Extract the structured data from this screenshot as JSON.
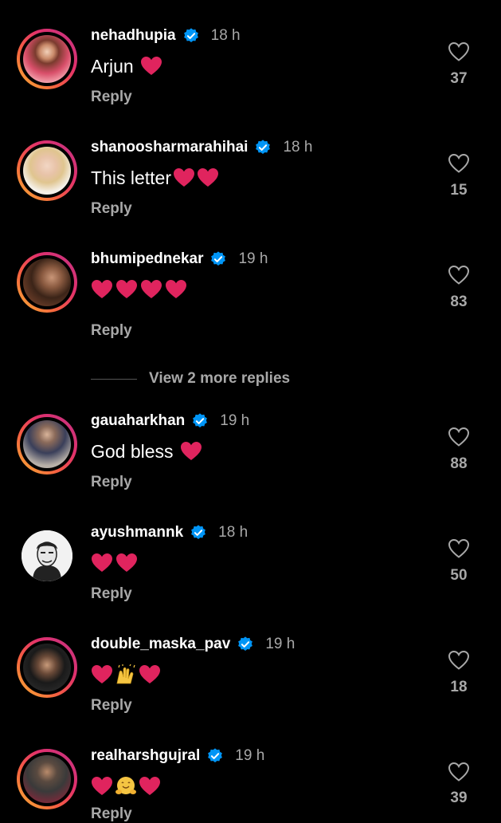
{
  "comments": [
    {
      "username": "nehadhupia",
      "time": "18 h",
      "text": "Arjun",
      "hearts": 1,
      "reply_label": "Reply",
      "likes": "37",
      "avatar_icon": "person-photo",
      "ring": true
    },
    {
      "username": "shanoosharmarahihai",
      "time": "18 h",
      "text": "This letter",
      "hearts": 2,
      "reply_label": "Reply",
      "likes": "15",
      "avatar_icon": "person-photo",
      "ring": true
    },
    {
      "username": "bhumipednekar",
      "time": "19 h",
      "text": "",
      "hearts": 4,
      "reply_label": "Reply",
      "likes": "83",
      "avatar_icon": "person-photo",
      "ring": true
    },
    {
      "username": "gauaharkhan",
      "time": "19 h",
      "text": "God bless",
      "hearts": 1,
      "reply_label": "Reply",
      "likes": "88",
      "avatar_icon": "person-photo",
      "ring": true
    },
    {
      "username": "ayushmannk",
      "time": "18 h",
      "text": "",
      "hearts": 2,
      "reply_label": "Reply",
      "likes": "50",
      "avatar_icon": "illustrated-portrait",
      "ring": false
    },
    {
      "username": "double_maska_pav",
      "time": "19 h",
      "text": "",
      "hearts": 2,
      "reply_label": "Reply",
      "likes": "18",
      "avatar_icon": "person-photo",
      "ring": true
    },
    {
      "username": "realharshgujral",
      "time": "19 h",
      "text": "",
      "hearts": 2,
      "reply_label": "Reply",
      "likes": "39",
      "avatar_icon": "person-photo",
      "ring": true
    }
  ],
  "view_more_replies": "View 2 more replies",
  "colors": {
    "background": "#000000",
    "text_primary": "#ffffff",
    "text_secondary": "#a8a8a8",
    "verified": "#0095f6",
    "heart": "#e0245e"
  },
  "icons": {
    "verified": "verified-badge-icon",
    "like": "heart-outline-icon",
    "emoji_heart": "red-heart-emoji",
    "emoji_raised_hands": "raised-hands-emoji",
    "emoji_hugging": "hugging-face-emoji"
  }
}
